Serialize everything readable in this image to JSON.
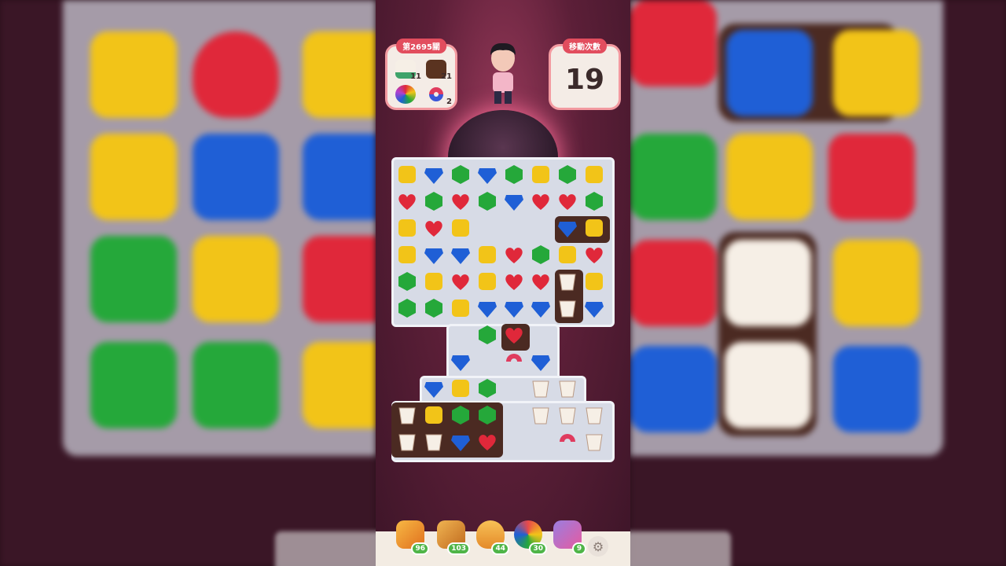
{
  "level": {
    "label": "第2695關"
  },
  "moves": {
    "label": "移動次數",
    "value": "19"
  },
  "goals": [
    {
      "icon": "coffee-cup-icon",
      "count": "11",
      "color": "#3fa36a"
    },
    {
      "icon": "chocolate-block-icon",
      "count": "21",
      "color": "#5a3320"
    },
    {
      "icon": "color-bomb-icon",
      "count": "",
      "color": "#e24d9a"
    },
    {
      "icon": "magnet-icon",
      "count": "2",
      "color": "#e03b5e"
    }
  ],
  "colors": {
    "red": "#e0283a",
    "blue": "#1f5fd6",
    "green": "#25a83a",
    "yellow": "#f2c418",
    "cup": "#f6efe6"
  },
  "boosters": [
    {
      "name": "hammer-icon",
      "count": "96",
      "color": "#f39a1f"
    },
    {
      "name": "cannon-icon",
      "count": "103",
      "color": "#e0902a"
    },
    {
      "name": "rocket-icon",
      "count": "44",
      "color": "#f0a83a"
    },
    {
      "name": "pinwheel-icon",
      "count": "30",
      "color": "#e94a4a"
    },
    {
      "name": "card-icon",
      "count": "9",
      "color": "#b96ad6"
    }
  ]
}
